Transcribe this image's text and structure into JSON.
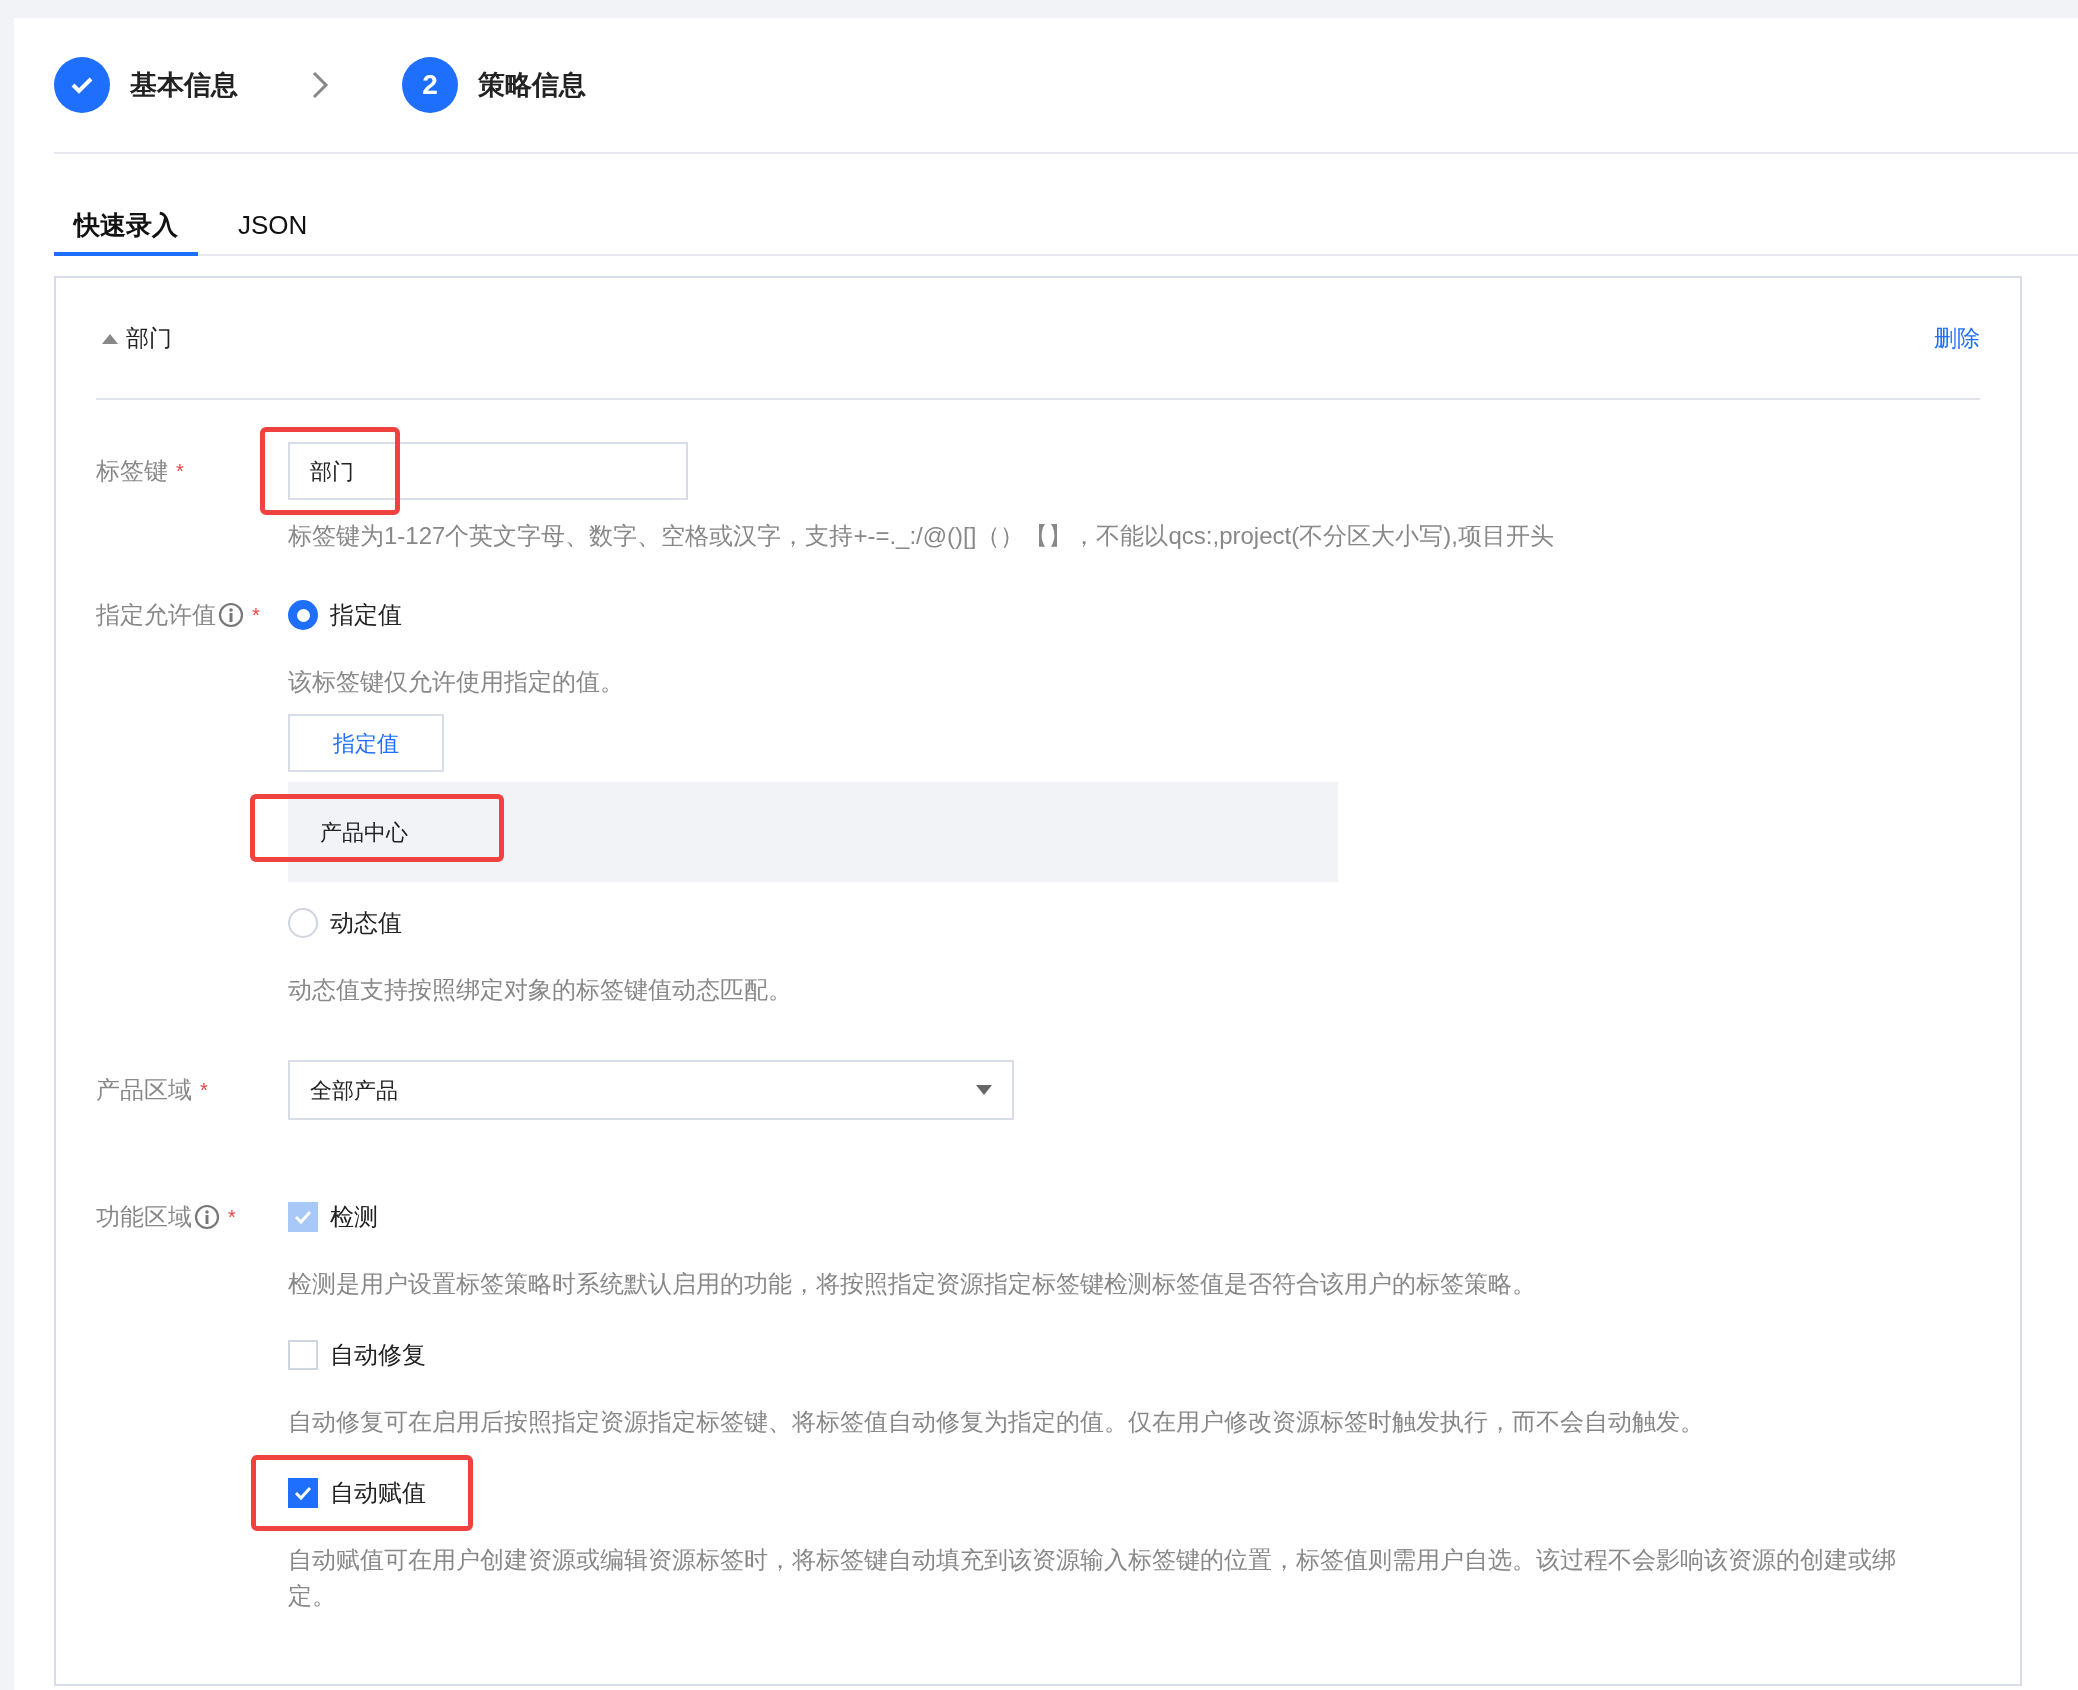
{
  "steps": [
    {
      "label": "基本信息",
      "kind": "done"
    },
    {
      "label": "策略信息",
      "number": "2",
      "kind": "current"
    }
  ],
  "tabs": [
    {
      "label": "快速录入",
      "selected": true
    },
    {
      "label": "JSON",
      "selected": false
    }
  ],
  "section": {
    "title": "部门",
    "expanded": true,
    "delete_link": "删除"
  },
  "tag_key": {
    "label": "标签键",
    "required_mark": "*",
    "value": "部门",
    "highlighted": true,
    "hint": "标签键为1-127个英文字母、数字、空格或汉字，支持+-=._:/@()[]（）【】，不能以qcs:,project(不分区大小写),项目开头"
  },
  "allowed_value": {
    "label": "指定允许值",
    "required_mark": "*",
    "options": [
      {
        "label": "指定值",
        "selected": true,
        "description": "该标签键仅允许使用指定的值。",
        "add_button": "指定值",
        "values": [
          {
            "text": "产品中心",
            "highlighted": true
          }
        ]
      },
      {
        "label": "动态值",
        "selected": false,
        "description": "动态值支持按照绑定对象的标签键值动态匹配。"
      }
    ]
  },
  "product_area": {
    "label": "产品区域",
    "required_mark": "*",
    "value": "全部产品"
  },
  "function_area": {
    "label": "功能区域",
    "required_mark": "*",
    "options": [
      {
        "label": "检测",
        "checked": true,
        "disabled": true,
        "description": "检测是用户设置标签策略时系统默认启用的功能，将按照指定资源指定标签键检测标签值是否符合该用户的标签策略。"
      },
      {
        "label": "自动修复",
        "checked": false,
        "disabled": false,
        "description": "自动修复可在启用后按照指定资源指定标签键、将标签值自动修复为指定的值。仅在用户修改资源标签时触发执行，而不会自动触发。"
      },
      {
        "label": "自动赋值",
        "checked": true,
        "disabled": false,
        "highlighted": true,
        "description": "自动赋值可在用户创建资源或编辑资源标签时，将标签键自动填充到该资源输入标签键的位置，标签值则需用户自选。该过程不会影响该资源的创建或绑定。"
      }
    ]
  }
}
